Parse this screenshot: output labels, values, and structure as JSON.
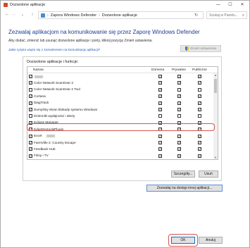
{
  "window": {
    "title": "Dozwolone aplikacje",
    "minimize": "—",
    "maximize": "☐",
    "close": "✕"
  },
  "address": {
    "back": "←",
    "forward": "→",
    "recent": "⌄",
    "up": "↑",
    "crumbs": [
      "Zapora Windows Defender",
      "Dozwolone aplikacje"
    ],
    "separator": "›",
    "refresh": "↻",
    "search_placeholder": "Szukaj w Panelu...",
    "search_icon": "⌕"
  },
  "main": {
    "title": "Zezwalaj aplikacjom na komunikowanie się przez Zaporę Windows Defender",
    "subtitle": "Aby dodać, zmienić lub usunąć dozwolone aplikacje i porty, kliknij pozycję Zmień ustawienia.",
    "risk_link": "Jakie ryzyko wiąże się z zezwoleniem na komunikację aplikacji?",
    "change_settings": "Zmień ustawienia"
  },
  "group": {
    "label": "Dozwolone aplikacje i funkcje:",
    "columns": {
      "name": "Nazwa",
      "domain": "Domena",
      "private": "Prywatne",
      "public": "Publiczne"
    },
    "rows": [
      {
        "name": "",
        "blur": true,
        "enabled": true,
        "domain": true,
        "private": true,
        "public": true
      },
      {
        "name": "Color Network ScanGear 2",
        "enabled": true,
        "domain": true,
        "private": true,
        "public": true
      },
      {
        "name": "Color Network ScanGear 2 Tool",
        "enabled": false,
        "domain": true,
        "private": false,
        "public": false
      },
      {
        "name": "Cortana",
        "enabled": true,
        "domain": true,
        "private": true,
        "public": true
      },
      {
        "name": "DiagTrack",
        "enabled": true,
        "domain": true,
        "private": true,
        "public": true
      },
      {
        "name": "Domyślny ekran blokady systemu Windows",
        "enabled": true,
        "domain": true,
        "private": true,
        "public": true
      },
      {
        "name": "Dzienniki wydajności i alerty",
        "enabled": false,
        "domain": false,
        "private": false,
        "public": false
      },
      {
        "name": "Eclipse Manager",
        "enabled": true,
        "domain": true,
        "private": true,
        "public": true
      },
      {
        "name": "EdgeDevtoolsPlugin",
        "enabled": true,
        "domain": true,
        "private": true,
        "public": true
      },
      {
        "name": "Excel",
        "blur": true,
        "enabled": true,
        "domain": true,
        "private": true,
        "public": true
      },
      {
        "name": "FarmVille 2: Country Escape",
        "enabled": true,
        "domain": true,
        "private": true,
        "public": true
      },
      {
        "name": "Feedback Hub",
        "enabled": true,
        "domain": true,
        "private": true,
        "public": true
      },
      {
        "name": "Filmy i TV",
        "enabled": true,
        "domain": true,
        "private": true,
        "public": true
      }
    ],
    "details_button": "Szczegóły...",
    "remove_button": "Usuń"
  },
  "allow_another": "Zezwalaj na dostęp innej aplikacji...",
  "footer": {
    "ok": "OK",
    "cancel": "Anuluj"
  },
  "scroll": {
    "up": "▲",
    "down": "▼"
  },
  "check_mark": "✓",
  "colors": {
    "title_blue": "#1e3d8f",
    "link_blue": "#1a5fb4",
    "highlight_red": "#d9534f",
    "ok_border": "#0078d7"
  }
}
